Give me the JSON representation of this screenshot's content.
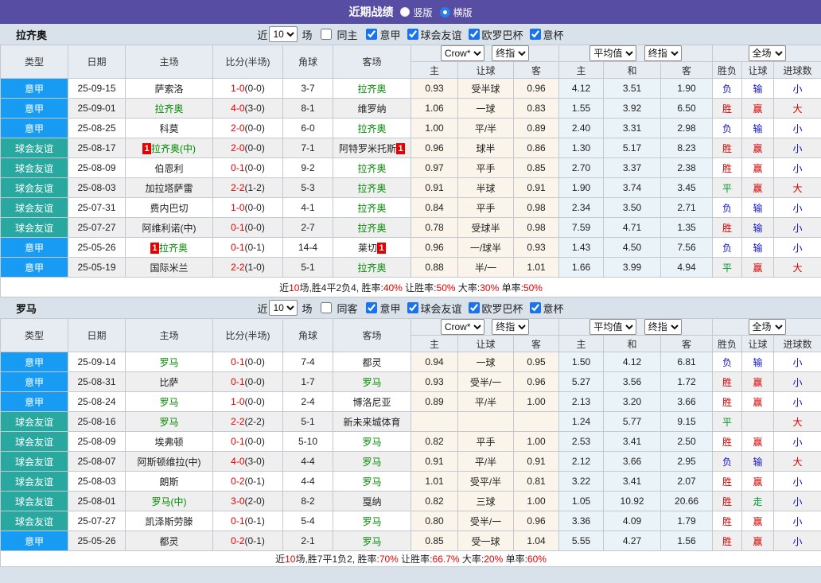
{
  "topbar": {
    "title": "近期战绩",
    "vertical": "竖版",
    "horizontal": "横版"
  },
  "filters": {
    "near_label": "近",
    "games_count": "10",
    "games_label": "场",
    "leagues": [
      "意甲",
      "球会友谊",
      "欧罗巴杯",
      "意杯"
    ]
  },
  "dropdowns": {
    "bookmaker": "Crow*",
    "final": "终指",
    "average": "平均值",
    "final2": "终指",
    "fulltime": "全场"
  },
  "columns": {
    "type": "类型",
    "date": "日期",
    "home": "主场",
    "score": "比分(半场)",
    "corner": "角球",
    "away": "客场",
    "h_home": "主",
    "h_line": "让球",
    "h_away": "客",
    "e_home": "主",
    "e_draw": "和",
    "e_away": "客",
    "winloss": "胜负",
    "handicap": "让球",
    "goals": "进球数"
  },
  "colors": {
    "titlebar_purple": "#574EA3",
    "league_blue": "#189BF2",
    "friendly_teal": "#29A8A0",
    "team_green": "#008A00",
    "score_red": "#E60000",
    "win_red": "#D40000",
    "lose_blue": "#1414CC",
    "draw_green": "#009933",
    "handicap_col_bg": "#FAF4EA",
    "average_col_bg": "#EAF3F8"
  },
  "sections": [
    {
      "team": "拉齐奥",
      "same_label": "同主",
      "rows": [
        {
          "type": "意甲",
          "cat": "lg",
          "date": "25-09-15",
          "home": {
            "t": "萨索洛"
          },
          "score": "1-0",
          "half": "(0-0)",
          "corner": "3-7",
          "away": {
            "t": "拉齐奥",
            "g": 1
          },
          "ah": [
            "0.93",
            "受半球",
            "0.96"
          ],
          "eu": [
            "4.12",
            "3.51",
            "1.90"
          ],
          "res": [
            [
              "负",
              "b"
            ],
            [
              "输",
              "b"
            ],
            [
              "小",
              "b"
            ]
          ]
        },
        {
          "type": "意甲",
          "cat": "lg",
          "date": "25-09-01",
          "home": {
            "t": "拉齐奥",
            "g": 1
          },
          "score": "4-0",
          "half": "(3-0)",
          "corner": "8-1",
          "away": {
            "t": "维罗纳"
          },
          "ah": [
            "1.06",
            "一球",
            "0.83"
          ],
          "eu": [
            "1.55",
            "3.92",
            "6.50"
          ],
          "res": [
            [
              "胜",
              "r"
            ],
            [
              "赢",
              "r"
            ],
            [
              "大",
              "r"
            ]
          ]
        },
        {
          "type": "意甲",
          "cat": "lg",
          "date": "25-08-25",
          "home": {
            "t": "科莫"
          },
          "score": "2-0",
          "half": "(0-0)",
          "corner": "6-0",
          "away": {
            "t": "拉齐奥",
            "g": 1
          },
          "ah": [
            "1.00",
            "平/半",
            "0.89"
          ],
          "eu": [
            "2.40",
            "3.31",
            "2.98"
          ],
          "res": [
            [
              "负",
              "b"
            ],
            [
              "输",
              "b"
            ],
            [
              "小",
              "b"
            ]
          ]
        },
        {
          "type": "球会友谊",
          "cat": "fr",
          "date": "25-08-17",
          "home": {
            "t": "拉齐奥(中)",
            "g": 1,
            "b": "pre"
          },
          "score": "2-0",
          "half": "(0-0)",
          "corner": "7-1",
          "away": {
            "t": "阿特罗米托斯",
            "b": "post"
          },
          "ah": [
            "0.96",
            "球半",
            "0.86"
          ],
          "eu": [
            "1.30",
            "5.17",
            "8.23"
          ],
          "res": [
            [
              "胜",
              "r"
            ],
            [
              "赢",
              "r"
            ],
            [
              "小",
              "b"
            ]
          ]
        },
        {
          "type": "球会友谊",
          "cat": "fr",
          "date": "25-08-09",
          "home": {
            "t": "伯恩利"
          },
          "score": "0-1",
          "half": "(0-0)",
          "corner": "9-2",
          "away": {
            "t": "拉齐奥",
            "g": 1
          },
          "ah": [
            "0.97",
            "平手",
            "0.85"
          ],
          "eu": [
            "2.70",
            "3.37",
            "2.38"
          ],
          "res": [
            [
              "胜",
              "r"
            ],
            [
              "赢",
              "r"
            ],
            [
              "小",
              "b"
            ]
          ]
        },
        {
          "type": "球会友谊",
          "cat": "fr",
          "date": "25-08-03",
          "home": {
            "t": "加拉塔萨雷"
          },
          "score": "2-2",
          "half": "(1-2)",
          "corner": "5-3",
          "away": {
            "t": "拉齐奥",
            "g": 1
          },
          "ah": [
            "0.91",
            "半球",
            "0.91"
          ],
          "eu": [
            "1.90",
            "3.74",
            "3.45"
          ],
          "res": [
            [
              "平",
              "g"
            ],
            [
              "赢",
              "r"
            ],
            [
              "大",
              "r"
            ]
          ]
        },
        {
          "type": "球会友谊",
          "cat": "fr",
          "date": "25-07-31",
          "home": {
            "t": "费内巴切"
          },
          "score": "1-0",
          "half": "(0-0)",
          "corner": "4-1",
          "away": {
            "t": "拉齐奥",
            "g": 1
          },
          "ah": [
            "0.84",
            "平手",
            "0.98"
          ],
          "eu": [
            "2.34",
            "3.50",
            "2.71"
          ],
          "res": [
            [
              "负",
              "b"
            ],
            [
              "输",
              "b"
            ],
            [
              "小",
              "b"
            ]
          ]
        },
        {
          "type": "球会友谊",
          "cat": "fr",
          "date": "25-07-27",
          "home": {
            "t": "阿维利诺(中)"
          },
          "score": "0-1",
          "half": "(0-0)",
          "corner": "2-7",
          "away": {
            "t": "拉齐奥",
            "g": 1
          },
          "ah": [
            "0.78",
            "受球半",
            "0.98"
          ],
          "eu": [
            "7.59",
            "4.71",
            "1.35"
          ],
          "res": [
            [
              "胜",
              "r"
            ],
            [
              "输",
              "b"
            ],
            [
              "小",
              "b"
            ]
          ]
        },
        {
          "type": "意甲",
          "cat": "lg",
          "date": "25-05-26",
          "home": {
            "t": "拉齐奥",
            "g": 1,
            "b": "pre"
          },
          "score": "0-1",
          "half": "(0-1)",
          "corner": "14-4",
          "away": {
            "t": "莱切",
            "b": "post"
          },
          "ah": [
            "0.96",
            "一/球半",
            "0.93"
          ],
          "eu": [
            "1.43",
            "4.50",
            "7.56"
          ],
          "res": [
            [
              "负",
              "b"
            ],
            [
              "输",
              "b"
            ],
            [
              "小",
              "b"
            ]
          ]
        },
        {
          "type": "意甲",
          "cat": "lg",
          "date": "25-05-19",
          "home": {
            "t": "国际米兰"
          },
          "score": "2-2",
          "half": "(1-0)",
          "corner": "5-1",
          "away": {
            "t": "拉齐奥",
            "g": 1
          },
          "ah": [
            "0.88",
            "半/一",
            "1.01"
          ],
          "eu": [
            "1.66",
            "3.99",
            "4.94"
          ],
          "res": [
            [
              "平",
              "g"
            ],
            [
              "赢",
              "r"
            ],
            [
              "大",
              "r"
            ]
          ]
        }
      ],
      "summary": [
        [
          "近",
          "k"
        ],
        [
          "10",
          "r"
        ],
        [
          "场,胜4平2负4, 胜率:",
          "k"
        ],
        [
          "40%",
          "r"
        ],
        [
          " 让胜率:",
          "k"
        ],
        [
          "50%",
          "r"
        ],
        [
          " 大率:",
          "k"
        ],
        [
          "30%",
          "r"
        ],
        [
          " 单率:",
          "k"
        ],
        [
          "50%",
          "r"
        ]
      ]
    },
    {
      "team": "罗马",
      "same_label": "同客",
      "rows": [
        {
          "type": "意甲",
          "cat": "lg",
          "date": "25-09-14",
          "home": {
            "t": "罗马",
            "g": 1
          },
          "score": "0-1",
          "half": "(0-0)",
          "corner": "7-4",
          "away": {
            "t": "都灵"
          },
          "ah": [
            "0.94",
            "一球",
            "0.95"
          ],
          "eu": [
            "1.50",
            "4.12",
            "6.81"
          ],
          "res": [
            [
              "负",
              "b"
            ],
            [
              "输",
              "b"
            ],
            [
              "小",
              "b"
            ]
          ]
        },
        {
          "type": "意甲",
          "cat": "lg",
          "date": "25-08-31",
          "home": {
            "t": "比萨"
          },
          "score": "0-1",
          "half": "(0-0)",
          "corner": "1-7",
          "away": {
            "t": "罗马",
            "g": 1
          },
          "ah": [
            "0.93",
            "受半/一",
            "0.96"
          ],
          "eu": [
            "5.27",
            "3.56",
            "1.72"
          ],
          "res": [
            [
              "胜",
              "r"
            ],
            [
              "赢",
              "r"
            ],
            [
              "小",
              "b"
            ]
          ]
        },
        {
          "type": "意甲",
          "cat": "lg",
          "date": "25-08-24",
          "home": {
            "t": "罗马",
            "g": 1
          },
          "score": "1-0",
          "half": "(0-0)",
          "corner": "2-4",
          "away": {
            "t": "博洛尼亚"
          },
          "ah": [
            "0.89",
            "平/半",
            "1.00"
          ],
          "eu": [
            "2.13",
            "3.20",
            "3.66"
          ],
          "res": [
            [
              "胜",
              "r"
            ],
            [
              "赢",
              "r"
            ],
            [
              "小",
              "b"
            ]
          ]
        },
        {
          "type": "球会友谊",
          "cat": "fr",
          "date": "25-08-16",
          "home": {
            "t": "罗马",
            "g": 1
          },
          "score": "2-2",
          "half": "(2-2)",
          "corner": "5-1",
          "away": {
            "t": "新未来城体育"
          },
          "ah": [
            "",
            "",
            ""
          ],
          "eu": [
            "1.24",
            "5.77",
            "9.15"
          ],
          "res": [
            [
              "平",
              "g"
            ],
            [
              "",
              ""
            ],
            [
              "大",
              "r"
            ]
          ]
        },
        {
          "type": "球会友谊",
          "cat": "fr",
          "date": "25-08-09",
          "home": {
            "t": "埃弗顿"
          },
          "score": "0-1",
          "half": "(0-0)",
          "corner": "5-10",
          "away": {
            "t": "罗马",
            "g": 1
          },
          "ah": [
            "0.82",
            "平手",
            "1.00"
          ],
          "eu": [
            "2.53",
            "3.41",
            "2.50"
          ],
          "res": [
            [
              "胜",
              "r"
            ],
            [
              "赢",
              "r"
            ],
            [
              "小",
              "b"
            ]
          ]
        },
        {
          "type": "球会友谊",
          "cat": "fr",
          "date": "25-08-07",
          "home": {
            "t": "阿斯顿维拉(中)"
          },
          "score": "4-0",
          "half": "(3-0)",
          "corner": "4-4",
          "away": {
            "t": "罗马",
            "g": 1
          },
          "ah": [
            "0.91",
            "平/半",
            "0.91"
          ],
          "eu": [
            "2.12",
            "3.66",
            "2.95"
          ],
          "res": [
            [
              "负",
              "b"
            ],
            [
              "输",
              "b"
            ],
            [
              "大",
              "r"
            ]
          ]
        },
        {
          "type": "球会友谊",
          "cat": "fr",
          "date": "25-08-03",
          "home": {
            "t": "朗斯"
          },
          "score": "0-2",
          "half": "(0-1)",
          "corner": "4-4",
          "away": {
            "t": "罗马",
            "g": 1
          },
          "ah": [
            "1.01",
            "受平/半",
            "0.81"
          ],
          "eu": [
            "3.22",
            "3.41",
            "2.07"
          ],
          "res": [
            [
              "胜",
              "r"
            ],
            [
              "赢",
              "r"
            ],
            [
              "小",
              "b"
            ]
          ]
        },
        {
          "type": "球会友谊",
          "cat": "fr",
          "date": "25-08-01",
          "home": {
            "t": "罗马(中)",
            "g": 1
          },
          "score": "3-0",
          "half": "(2-0)",
          "corner": "8-2",
          "away": {
            "t": "戛纳"
          },
          "ah": [
            "0.82",
            "三球",
            "1.00"
          ],
          "eu": [
            "1.05",
            "10.92",
            "20.66"
          ],
          "res": [
            [
              "胜",
              "r"
            ],
            [
              "走",
              "g"
            ],
            [
              "小",
              "b"
            ]
          ]
        },
        {
          "type": "球会友谊",
          "cat": "fr",
          "date": "25-07-27",
          "home": {
            "t": "凯泽斯劳滕"
          },
          "score": "0-1",
          "half": "(0-1)",
          "corner": "5-4",
          "away": {
            "t": "罗马",
            "g": 1
          },
          "ah": [
            "0.80",
            "受半/一",
            "0.96"
          ],
          "eu": [
            "3.36",
            "4.09",
            "1.79"
          ],
          "res": [
            [
              "胜",
              "r"
            ],
            [
              "赢",
              "r"
            ],
            [
              "小",
              "b"
            ]
          ]
        },
        {
          "type": "意甲",
          "cat": "lg",
          "date": "25-05-26",
          "home": {
            "t": "都灵"
          },
          "score": "0-2",
          "half": "(0-1)",
          "corner": "2-1",
          "away": {
            "t": "罗马",
            "g": 1
          },
          "ah": [
            "0.85",
            "受一球",
            "1.04"
          ],
          "eu": [
            "5.55",
            "4.27",
            "1.56"
          ],
          "res": [
            [
              "胜",
              "r"
            ],
            [
              "赢",
              "r"
            ],
            [
              "小",
              "b"
            ]
          ]
        }
      ],
      "summary": [
        [
          "近",
          "k"
        ],
        [
          "10",
          "r"
        ],
        [
          "场,胜7平1负2, 胜率:",
          "k"
        ],
        [
          "70%",
          "r"
        ],
        [
          " 让胜率:",
          "k"
        ],
        [
          "66.7%",
          "r"
        ],
        [
          " 大率:",
          "k"
        ],
        [
          "20%",
          "r"
        ],
        [
          " 单率:",
          "k"
        ],
        [
          "60%",
          "r"
        ]
      ]
    }
  ]
}
